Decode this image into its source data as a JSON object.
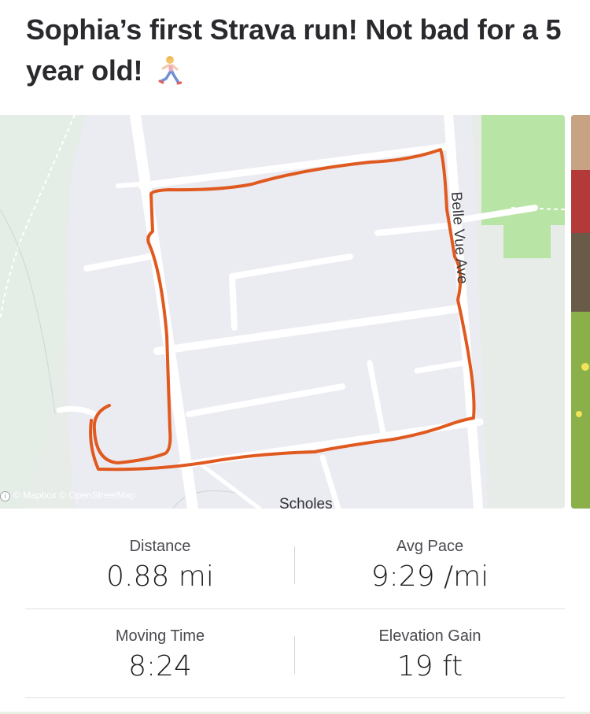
{
  "post": {
    "title": "Sophia’s first Strava run! Not bad for a 5 year old!",
    "emoji_icon": "woman-running-icon"
  },
  "map": {
    "street_label": "Belle Vue Ave",
    "area_label": "Scholes",
    "attribution": "© Mapbox © OpenStreetMap",
    "route_color": "#e05a20",
    "park_color": "#b7e4a5",
    "land_color": "#ebebf0",
    "road_color": "#ffffff"
  },
  "stats": {
    "distance": {
      "label": "Distance",
      "value": "0.88 mi"
    },
    "avg_pace": {
      "label": "Avg Pace",
      "value": "9:29 /mi"
    },
    "moving_time": {
      "label": "Moving Time",
      "value": "8:24"
    },
    "elevation_gain": {
      "label": "Elevation Gain",
      "value": "19 ft"
    }
  }
}
